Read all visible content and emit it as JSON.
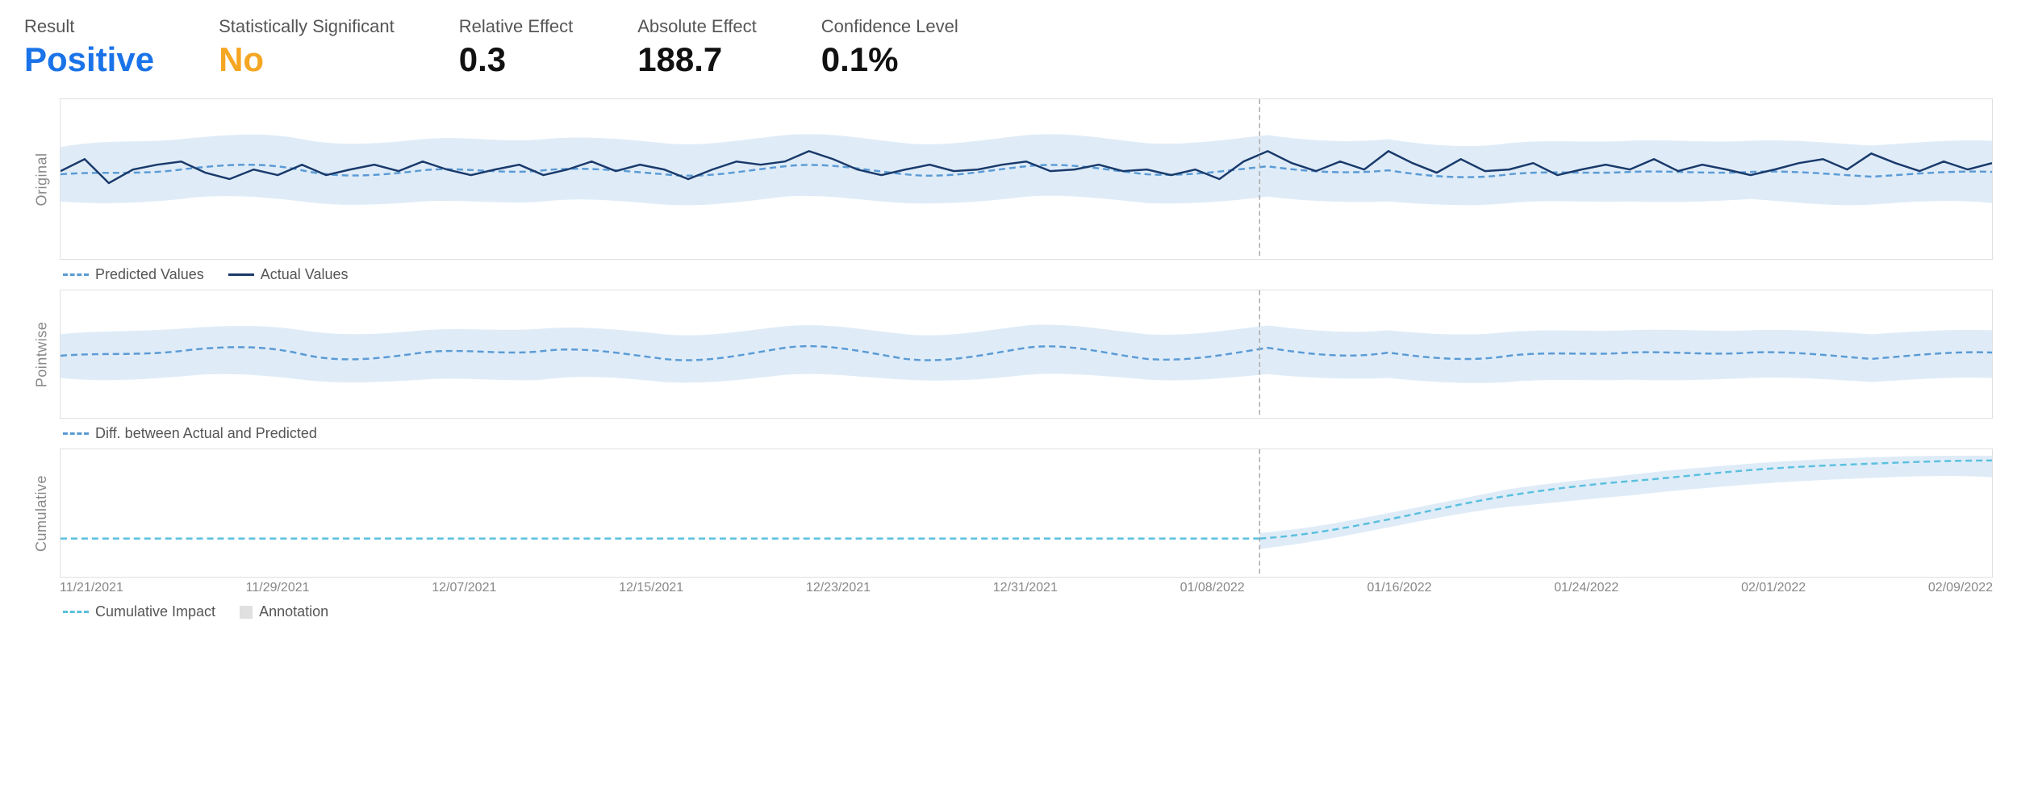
{
  "header": {
    "metrics": [
      {
        "label": "Result",
        "value": "Positive",
        "class": "positive"
      },
      {
        "label": "Statistically Significant",
        "value": "No",
        "class": "no"
      },
      {
        "label": "Relative Effect",
        "value": "0.3",
        "class": "normal"
      },
      {
        "label": "Absolute Effect",
        "value": "188.7",
        "class": "normal"
      },
      {
        "label": "Confidence Level",
        "value": "0.1%",
        "class": "normal"
      }
    ]
  },
  "charts": {
    "original_label": "Original",
    "pointwise_label": "Pointwise",
    "cumulative_label": "Cumulative"
  },
  "legends": {
    "predicted": "Predicted Values",
    "actual": "Actual Values",
    "diff": "Diff. between Actual and Predicted",
    "cumulative_impact": "Cumulative Impact",
    "annotation": "Annotation"
  },
  "xaxis": {
    "labels": [
      "11/21/2021",
      "11/29/2021",
      "12/07/2021",
      "12/15/2021",
      "12/23/2021",
      "12/31/2021",
      "01/08/2022",
      "01/16/2022",
      "01/24/2022",
      "02/01/2022",
      "02/09/2022"
    ]
  }
}
